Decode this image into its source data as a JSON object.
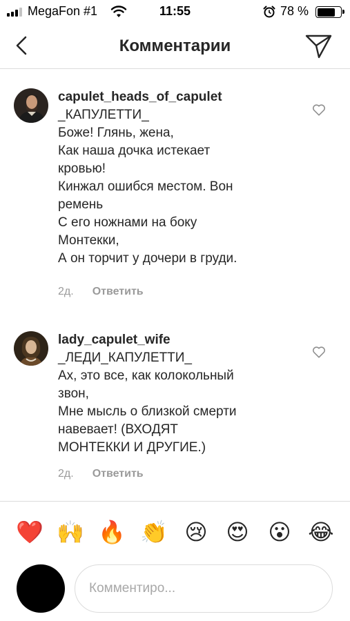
{
  "status_bar": {
    "carrier": "MegaFon #1",
    "time": "11:55",
    "battery_percent": "78 %",
    "battery_level": 0.78,
    "signal_bars": 3,
    "icons": [
      "signal-icon",
      "wifi-icon",
      "alarm-icon",
      "battery-icon"
    ]
  },
  "header": {
    "title": "Комментарии",
    "back_icon": "chevron-left-icon",
    "share_icon": "paper-plane-icon"
  },
  "comments": [
    {
      "username": "capulet_heads_of_capulet",
      "text": "_КАПУЛЕТТИ_\nБоже! Глянь, жена,\nКак наша дочка истекает\nкровью!\nКинжал ошибся местом. Вон\nремень\nС его ножнами на боку\nМонтекки,\nА он торчит у дочери в груди.",
      "time": "2д.",
      "reply_label": "Ответить",
      "like_icon": "heart-outline-icon"
    },
    {
      "username": "lady_capulet_wife",
      "text": "_ЛЕДИ_КАПУЛЕТТИ_\nАх, это все, как колокольный\nзвон,\nМне мысль о близкой смерти\nнавевает! (ВХОДЯТ\nМОНТЕККИ И ДРУГИЕ.)",
      "time": "2д.",
      "reply_label": "Ответить",
      "like_icon": "heart-outline-icon"
    }
  ],
  "emoji_bar": [
    "❤️",
    "🙌",
    "🔥",
    "👏",
    "😢",
    "😍",
    "😮",
    "😂"
  ],
  "composer": {
    "placeholder": "Комментиро..."
  },
  "colors": {
    "text": "#262626",
    "secondary": "#9a9a9a",
    "divider": "#dbdbdb"
  }
}
